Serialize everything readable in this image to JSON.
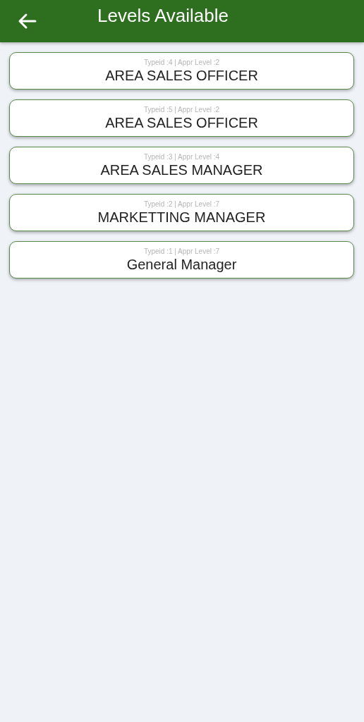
{
  "app_bar": {
    "title": "Levels Available"
  },
  "levels": [
    {
      "meta": "Typeid :4 | Appr Level :2",
      "name": "AREA SALES OFFICER"
    },
    {
      "meta": "Typeid :5 | Appr Level :2",
      "name": "AREA SALES OFFICER"
    },
    {
      "meta": "Typeid :3 | Appr Level :4",
      "name": "AREA SALES MANAGER"
    },
    {
      "meta": "Typeid :2 | Appr Level :7",
      "name": "MARKETTING MANAGER"
    },
    {
      "meta": "Typeid :1 | Appr Level :7",
      "name": "General Manager"
    }
  ]
}
